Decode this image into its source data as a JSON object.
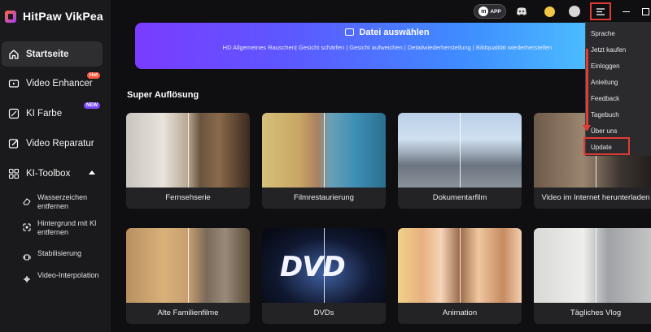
{
  "app": {
    "title": "HitPaw VikPea"
  },
  "sidebar": {
    "items": [
      {
        "label": "Startseite",
        "icon": "home-icon",
        "active": true
      },
      {
        "label": "Video Enhancer",
        "icon": "video-enhancer-icon",
        "badge": "Hot"
      },
      {
        "label": "KI Farbe",
        "icon": "ai-color-icon",
        "badge": "NEW"
      },
      {
        "label": "Video Reparatur",
        "icon": "repair-icon"
      },
      {
        "label": "KI-Toolbox",
        "icon": "toolbox-icon",
        "expanded": true
      }
    ],
    "toolbox": [
      {
        "label": "Wasserzeichen entfernen",
        "icon": "eraser-icon"
      },
      {
        "label": "Hintergrund mit KI entfernen",
        "icon": "background-remove-icon"
      },
      {
        "label": "Stabilisierung",
        "icon": "stabilize-icon"
      },
      {
        "label": "Video-Interpolation",
        "icon": "interpolation-icon"
      }
    ]
  },
  "topbar": {
    "app_badge": "APP"
  },
  "banner": {
    "title": "Datei auswählen",
    "subtitle": "HD Allgemeines Rauschen| Gesicht schärfen | Gesicht aufweichen | Detailwiederherstellung | Bildqualität wiederherstellen"
  },
  "section": {
    "title": "Super Auflösung"
  },
  "cards": [
    {
      "label": "Fernsehserie"
    },
    {
      "label": "Filmrestaurierung"
    },
    {
      "label": "Dokumentarfilm"
    },
    {
      "label": "Video im Internet herunterladen"
    },
    {
      "label": "Alte Familienfilme"
    },
    {
      "label": "DVDs"
    },
    {
      "label": "Animation"
    },
    {
      "label": "Tägliches Vlog"
    }
  ],
  "menu": {
    "items": [
      "Sprache",
      "Jetzt kaufen",
      "Einloggen",
      "Anleitung",
      "Feedback",
      "Tagebuch",
      "Über uns",
      "Update"
    ],
    "highlighted": "Update"
  },
  "colors": {
    "accent": "#7a3cff",
    "highlight": "#e23b33",
    "sidebar": "#1a1a1c"
  }
}
